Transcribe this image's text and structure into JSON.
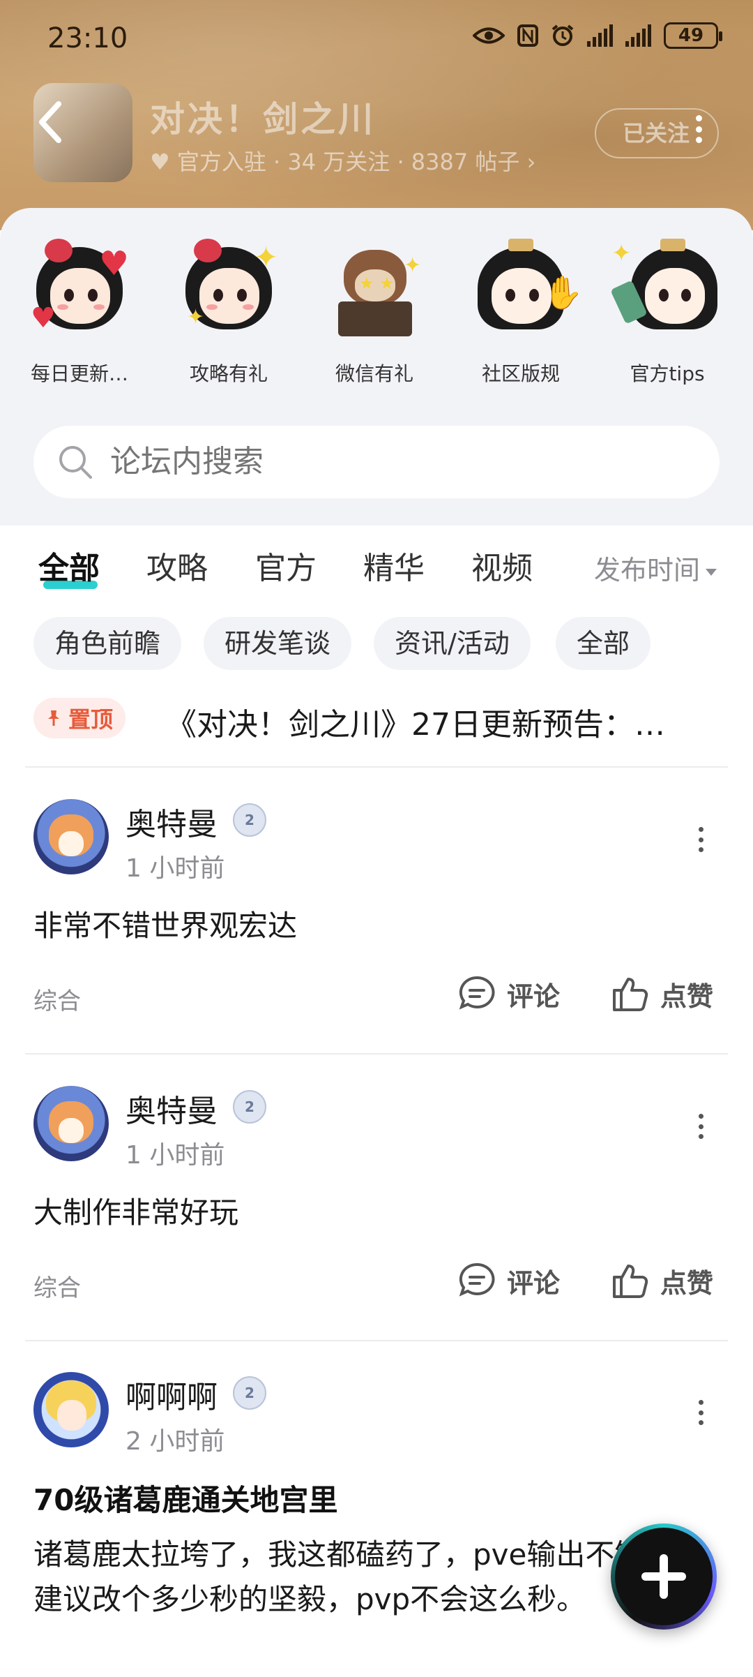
{
  "status_bar": {
    "time": "23:10",
    "battery": "49"
  },
  "forum": {
    "title": "对决！剑之川",
    "meta": "♥ 官方入驻 · 34 万关注 · 8387 帖子 ›",
    "follow_label": "已关注"
  },
  "shortcuts": [
    {
      "label": "每日更新…",
      "icon": "character-heart-icon"
    },
    {
      "label": "攻略有礼",
      "icon": "character-sparkle-icon"
    },
    {
      "label": "微信有礼",
      "icon": "cat-chest-icon"
    },
    {
      "label": "社区版规",
      "icon": "swordsman-icon"
    },
    {
      "label": "官方tips",
      "icon": "swordsman-tips-icon"
    }
  ],
  "search": {
    "placeholder": "论坛内搜索"
  },
  "tabs": [
    "全部",
    "攻略",
    "官方",
    "精华",
    "视频"
  ],
  "sort_label": "发布时间",
  "chips": [
    "角色前瞻",
    "研发笔谈",
    "资讯/活动",
    "全部"
  ],
  "pinned": {
    "badge": "置顶",
    "text": "《对决！剑之川》27日更新预告：…"
  },
  "posts": [
    {
      "author": "奥特曼",
      "level": "2",
      "time": "1 小时前",
      "title": "",
      "body": "非常不错世界观宏达",
      "tag": "综合",
      "comment_label": "评论",
      "like_label": "点赞"
    },
    {
      "author": "奥特曼",
      "level": "2",
      "time": "1 小时前",
      "title": "",
      "body": "大制作非常好玩",
      "tag": "综合",
      "comment_label": "评论",
      "like_label": "点赞"
    },
    {
      "author": "啊啊啊",
      "level": "2",
      "time": "2 小时前",
      "title": "70级诸葛鹿通关地宫里",
      "body": "诸葛鹿太拉垮了，我这都磕药了，pve输出不够啊，建议改个多少秒的坚毅，pvp不会这么秒。"
    }
  ],
  "colors": {
    "accent": "#2bcfd0",
    "pin": "#e85a3a",
    "header": "#c49a66"
  }
}
